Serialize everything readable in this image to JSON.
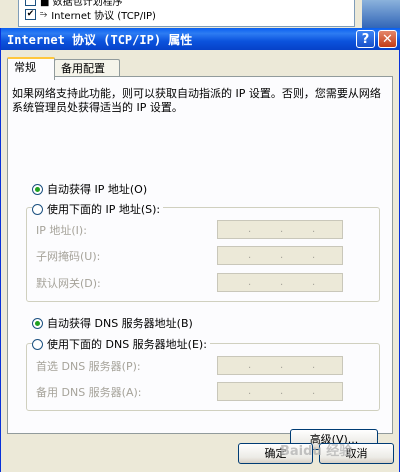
{
  "background": {
    "list_row_partial": "■ 数据包计划程序",
    "list_row": "Internet 协议 (TCP/IP)"
  },
  "dialog": {
    "title": "Internet 协议 (TCP/IP) 属性",
    "help_button": "?",
    "close_button": "✕"
  },
  "tabs": [
    "常规",
    "备用配置"
  ],
  "description": "如果网络支持此功能，则可以获取自动指派的 IP 设置。否则，您需要从网络系统管理员处获得适当的 IP 设置。",
  "ip": {
    "auto_label": "自动获得 IP 地址(O)",
    "manual_label": "使用下面的 IP 地址(S):",
    "auto_selected": true,
    "fields": [
      {
        "label": "IP 地址(I):"
      },
      {
        "label": "子网掩码(U):"
      },
      {
        "label": "默认网关(D):"
      }
    ]
  },
  "dns": {
    "auto_label": "自动获得 DNS 服务器地址(B)",
    "manual_label": "使用下面的 DNS 服务器地址(E):",
    "auto_selected": true,
    "fields": [
      {
        "label": "首选 DNS 服务器(P):"
      },
      {
        "label": "备用 DNS 服务器(A):"
      }
    ]
  },
  "buttons": {
    "advanced": "高级(V)...",
    "ok": "确定",
    "cancel": "取消"
  },
  "watermark": "Baidu 经验"
}
